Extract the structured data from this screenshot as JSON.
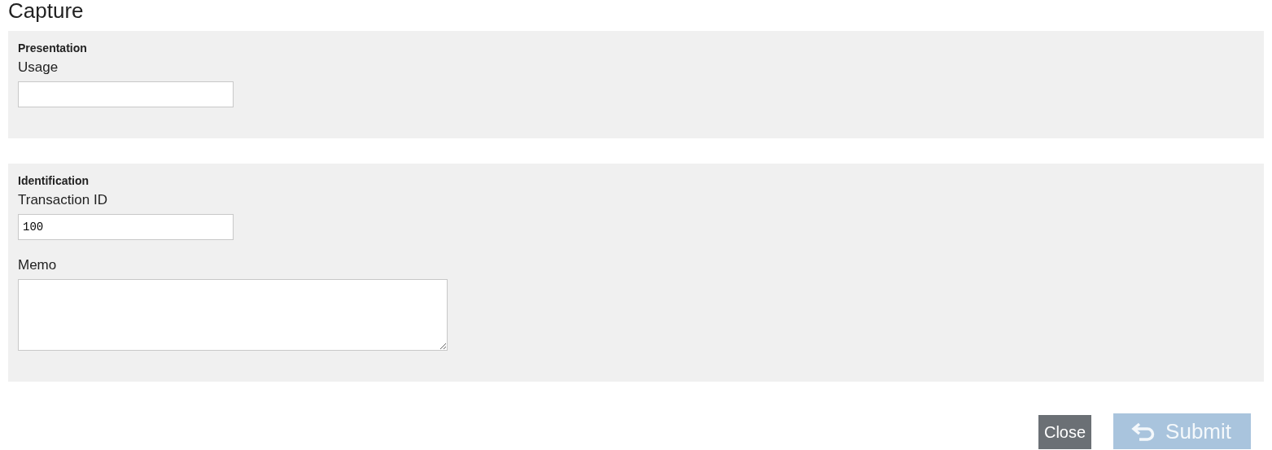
{
  "title": "Capture",
  "sections": [
    {
      "heading": "Presentation",
      "fields": [
        {
          "kind": "text",
          "label": "Usage"
        }
      ]
    },
    {
      "heading": "Identification",
      "fields": [
        {
          "kind": "text",
          "label": "Transaction ID",
          "value": "100"
        },
        {
          "kind": "textarea",
          "label": "Memo"
        }
      ]
    }
  ],
  "buttons": [
    {
      "kind": "plain",
      "label": "Close",
      "disabled": false
    },
    {
      "kind": "submit",
      "label": "Submit",
      "disabled": true
    }
  ]
}
